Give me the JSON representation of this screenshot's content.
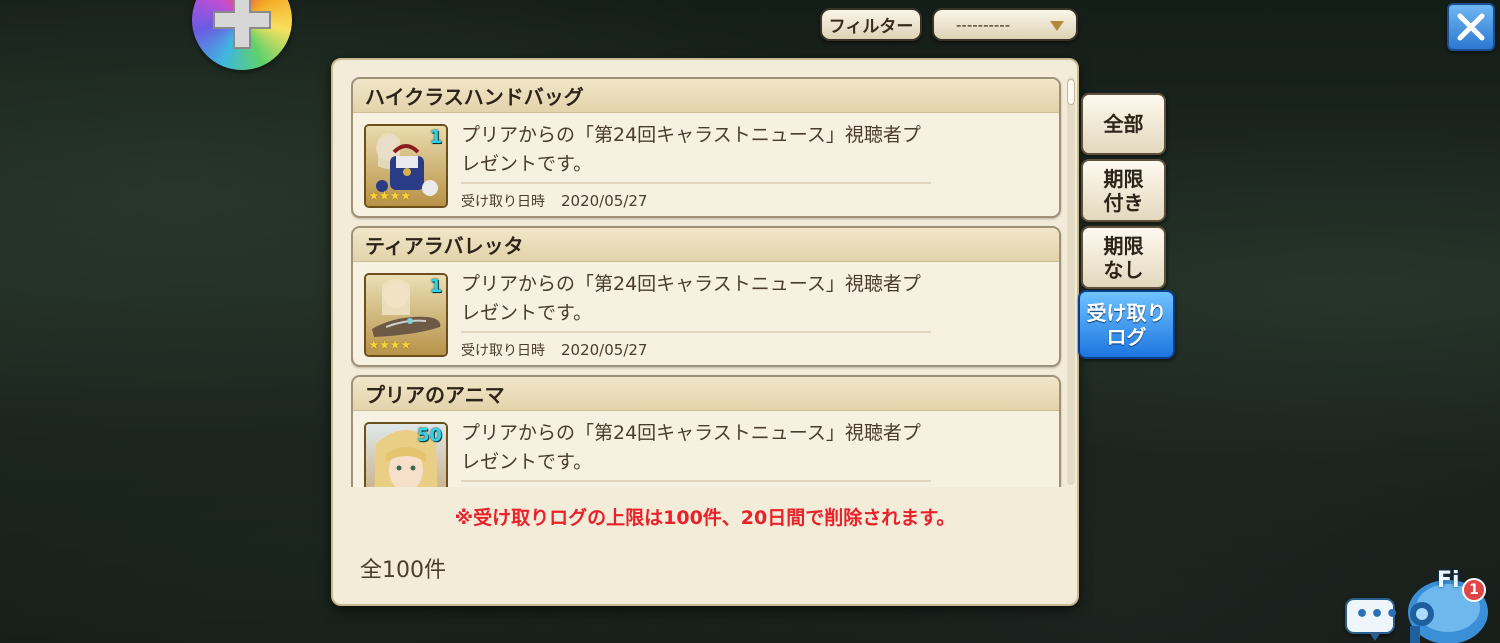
{
  "header": {
    "filter_label": "フィルター",
    "filter_value": "----------",
    "close_icon": "close-x-icon",
    "dpad_icon": "dpad-icon"
  },
  "items": [
    {
      "title": "ハイクラスハンドバッグ",
      "quantity": "1",
      "stars": "★★★★",
      "rarity_stars": 4,
      "description": "プリアからの「第24回キャラストニュース」視聴者プレゼントです。",
      "date_label": "受け取り日時",
      "date": "2020/05/27"
    },
    {
      "title": "ティアラバレッタ",
      "quantity": "1",
      "stars": "★★★★",
      "rarity_stars": 4,
      "description": "プリアからの「第24回キャラストニュース」視聴者プレゼントです。",
      "date_label": "受け取り日時",
      "date": "2020/05/27"
    },
    {
      "title": "プリアのアニマ",
      "quantity": "50",
      "description": "プリアからの「第24回キャラストニュース」視聴者プレゼントです。"
    }
  ],
  "notice": "※受け取りログの上限は100件、20日間で削除されます。",
  "count": "全100件",
  "tabs": [
    {
      "line1": "全部",
      "line2": ""
    },
    {
      "line1": "期限",
      "line2": "付き"
    },
    {
      "line1": "期限",
      "line2": "なし"
    },
    {
      "line1": "受け取り",
      "line2": "ログ",
      "active": true
    }
  ],
  "bottom": {
    "chat_dots": "•••",
    "mascot_text": "Fi",
    "mascot_badge": "1"
  },
  "colors": {
    "panel_bg": "#f3ecd9",
    "notice_red": "#e8212b",
    "active_tab_blue": "#1c75df",
    "quantity_cyan": "#2fd3e4"
  }
}
